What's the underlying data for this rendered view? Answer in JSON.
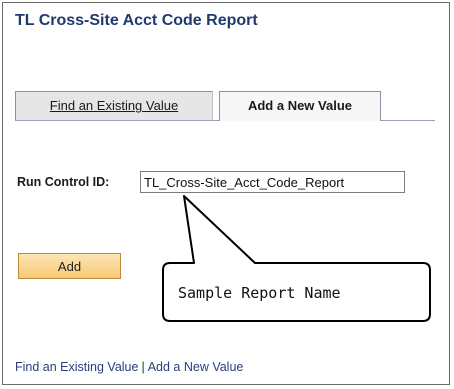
{
  "page": {
    "title": "TL Cross-Site Acct Code Report"
  },
  "tabs": [
    {
      "label": "Find an Existing Value",
      "active": false
    },
    {
      "label": "Add a New Value",
      "active": true
    }
  ],
  "form": {
    "run_control_label": "Run Control ID:",
    "run_control_value": "TL_Cross-Site_Acct_Code_Report",
    "add_button_label": "Add"
  },
  "callout": {
    "text": "Sample Report Name"
  },
  "footer_links": {
    "find_existing": "Find an Existing Value",
    "separator": "|",
    "add_new": "Add a New Value"
  },
  "colors": {
    "title": "#1f3a6e",
    "link": "#2a3f7a",
    "button_fill": "#f6c977"
  }
}
